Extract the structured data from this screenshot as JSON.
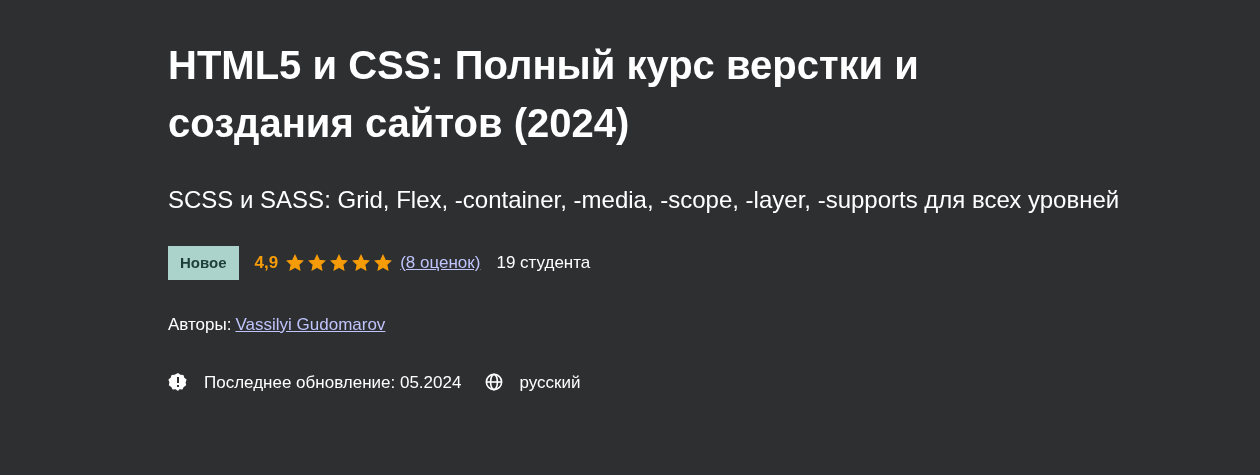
{
  "course": {
    "title": "HTML5 и CSS: Полный курс верстки и создания сайтов (2024)",
    "subtitle": "SCSS и SASS: Grid, Flex, -container, -media, -scope, -layer, -supports для всех уровней",
    "badge": "Новое",
    "rating": "4,9",
    "stars": 5,
    "ratings_count": "(8 оценок)",
    "students": "19 студента",
    "authors_label": "Авторы:",
    "author": "Vassilyi Gudomarov",
    "updated": "Последнее обновление: 05.2024",
    "language": "русский"
  }
}
